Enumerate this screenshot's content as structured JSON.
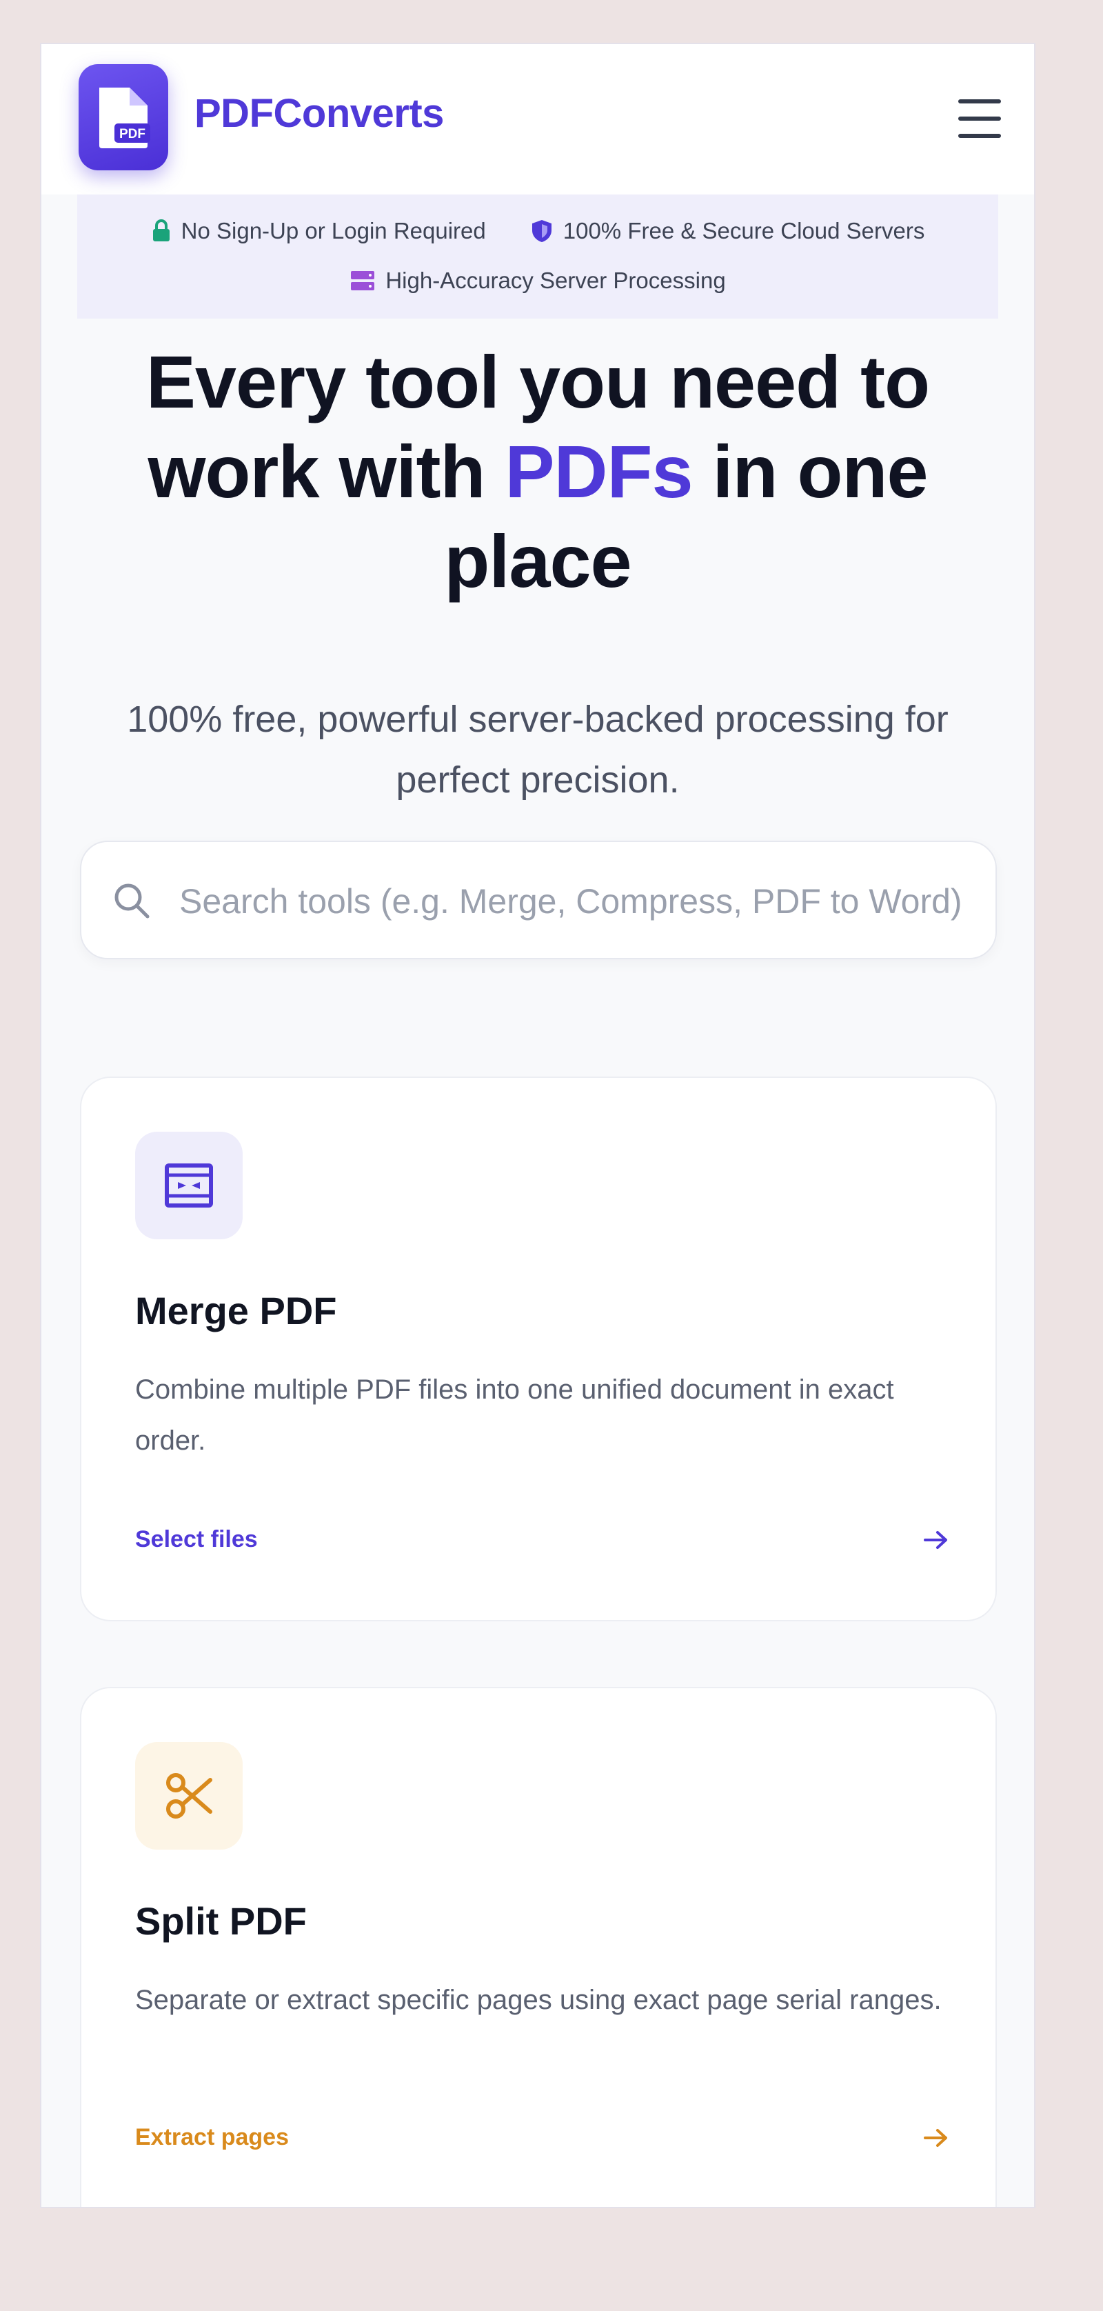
{
  "brand": {
    "name": "PDFConverts",
    "logo_text": "PDF"
  },
  "trust": {
    "items": [
      {
        "icon": "lock-icon",
        "label": "No Sign-Up or Login Required",
        "color": "#1aa37a"
      },
      {
        "icon": "shield-icon",
        "label": "100% Free & Secure Cloud Servers",
        "color": "#4f39d8"
      },
      {
        "icon": "server-icon",
        "label": "High-Accuracy Server Processing",
        "color": "#9b4fd8"
      }
    ]
  },
  "hero": {
    "title_before": "Every tool you need to work with ",
    "title_highlight": "PDFs",
    "title_after": " in one place",
    "subtitle": "100% free, powerful server-backed processing for perfect precision."
  },
  "search": {
    "placeholder": "Search tools (e.g. Merge, Compress, PDF to Word)",
    "value": ""
  },
  "tools": [
    {
      "icon": "merge-icon",
      "title": "Merge PDF",
      "description": "Combine multiple PDF files into one unified document in exact order.",
      "action": "Select files",
      "accent": "#4f39d8",
      "icon_bg": "#eeedfb"
    },
    {
      "icon": "scissors-icon",
      "title": "Split PDF",
      "description": "Separate or extract specific pages using exact page serial ranges.",
      "action": "Extract pages",
      "accent": "#d98a1c",
      "icon_bg": "#fdf5e6"
    }
  ],
  "colors": {
    "brand": "#4f39d8",
    "background": "#f8f9fb"
  }
}
